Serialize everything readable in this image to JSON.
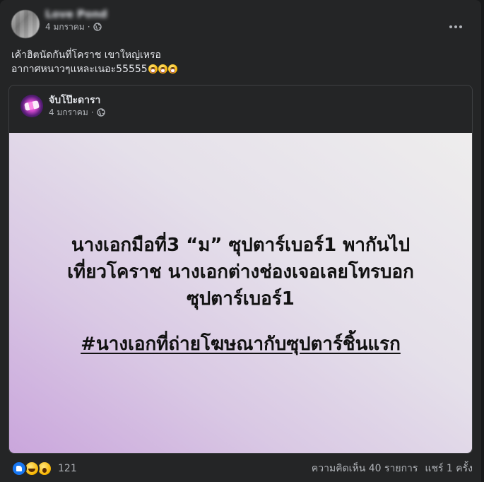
{
  "post": {
    "author_name": "Love Pond",
    "timestamp": "4 มกราคม",
    "privacy_icon": "globe-icon",
    "text_lines": [
      "เค้าฮิตนัดกันที่โคราช เขาใหญ่เหรอ",
      "อากาศหนาวๆแหละเนอะ55555"
    ],
    "emojis": [
      "scream-emoji",
      "scream-emoji",
      "scream-emoji"
    ]
  },
  "shared": {
    "page_name": "จับโป๊ะดารา",
    "timestamp": "4 มกราคม",
    "image_lines": [
      "นางเอกมือที่3 “ม” ซุปตาร์เบอร์1 พากันไป",
      "เที่ยวโคราช นางเอกต่างช่องเจอเลยโทรบอก",
      "ซุปตาร์เบอร์1"
    ],
    "image_hashtag": "#นางเอกที่ถ่ายโฆษณากับซุปตาร์ชิ้นแรก"
  },
  "footer": {
    "reaction_icons": [
      "like-icon",
      "haha-icon",
      "wow-icon"
    ],
    "reaction_count": "121",
    "comments": "ความคิดเห็น 40 รายการ",
    "shares": "แชร์ 1 ครั้ง"
  },
  "colors": {
    "background": "#242526",
    "text": "#e4e6eb",
    "secondary_text": "#b0b3b8",
    "like_blue": "#1877f2"
  }
}
